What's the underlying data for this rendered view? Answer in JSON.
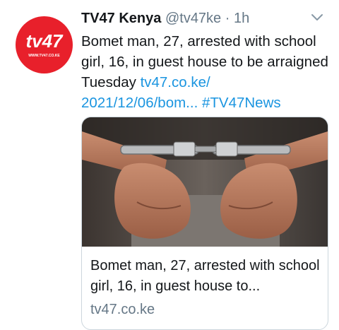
{
  "account": {
    "display_name": "TV47 Kenya",
    "handle": "@tv47ke",
    "separator": "·",
    "time": "1h",
    "avatar_logo_text": "tv47",
    "avatar_url_text": "WWW.TV47.CO.KE"
  },
  "tweet": {
    "text": "Bomet man, 27, arrested with school girl, 16, in guest house to be arraigned Tuesday ",
    "link_line1": "tv47.co.ke/",
    "link_line2": "2021/12/06/bom...",
    "hashtag": "#TV47News"
  },
  "card": {
    "title": "Bomet man, 27, arrested with school girl, 16, in guest house to...",
    "domain": "tv47.co.ke"
  },
  "icons": {
    "caret": "chevron-down-icon"
  },
  "colors": {
    "brand_red": "#e8202b",
    "link_blue": "#1b95e0",
    "muted_gray": "#657786"
  }
}
